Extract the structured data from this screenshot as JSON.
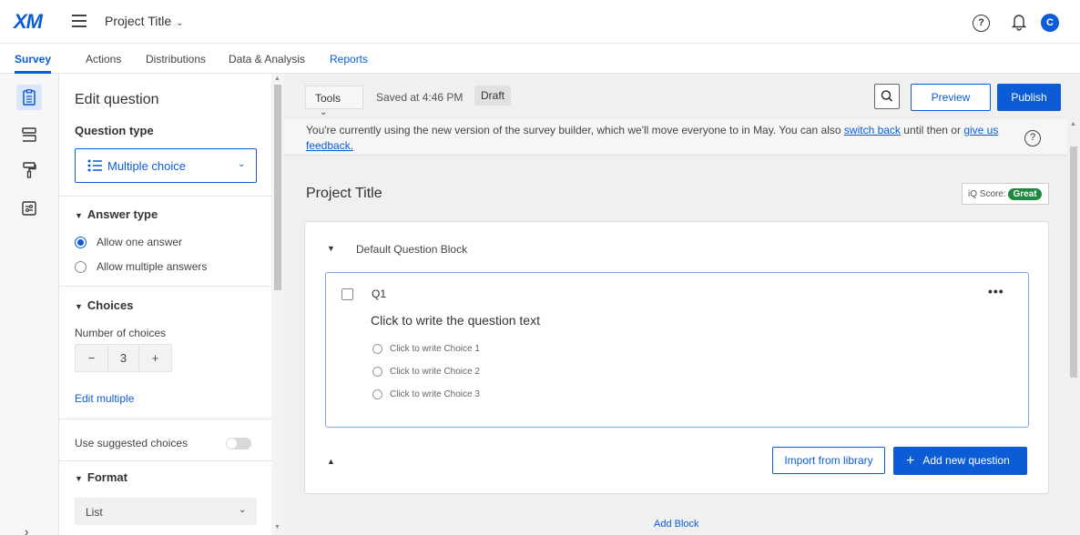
{
  "app": {
    "logo": "XM",
    "project_title": "Project Title",
    "user_initial": "C",
    "brand_color": "#0b5cd5"
  },
  "topbar": {
    "menu_icon": "hamburger-icon",
    "help_icon": "help-icon",
    "notification_icon": "bell-icon",
    "help_glyph": "?"
  },
  "nav": {
    "tabs": [
      {
        "label": "Survey",
        "active": true
      },
      {
        "label": "Actions"
      },
      {
        "label": "Distributions"
      },
      {
        "label": "Data & Analysis"
      },
      {
        "label": "Reports"
      }
    ]
  },
  "rail": {
    "icons": [
      "survey-icon",
      "blocks-icon",
      "look-and-feel-icon",
      "survey-options-icon"
    ],
    "expand_glyph": "›"
  },
  "edit_panel": {
    "title": "Edit question",
    "question_type_label": "Question type",
    "question_type_value": "Multiple choice",
    "answer_type_label": "Answer type",
    "answer_options": [
      {
        "label": "Allow one answer",
        "checked": true
      },
      {
        "label": "Allow multiple answers",
        "checked": false
      }
    ],
    "choices_label": "Choices",
    "number_of_choices_label": "Number of choices",
    "stepper": {
      "minus": "−",
      "value": "3",
      "plus": "+"
    },
    "edit_multiple": "Edit multiple",
    "use_suggested_label": "Use suggested choices",
    "use_suggested_on": false,
    "format_label": "Format",
    "format_value": "List"
  },
  "toolbar": {
    "tools_label": "Tools",
    "saved_text": "Saved at 4:46 PM",
    "draft_badge": "Draft",
    "preview_label": "Preview",
    "publish_label": "Publish"
  },
  "banner": {
    "text_before": "You're currently using the new version of the survey builder, which we'll move everyone to in May. You can also ",
    "link_switch": "switch back",
    "text_middle": " until then or ",
    "link_feedback_1": "give us",
    "link_feedback_2": "feedback."
  },
  "survey": {
    "title": "Project Title",
    "iq_label": "iQ Score:",
    "iq_value": "Great",
    "block_name": "Default Question Block",
    "question": {
      "id": "Q1",
      "text": "Click to write the question text",
      "choices": [
        "Click to write Choice 1",
        "Click to write Choice 2",
        "Click to write Choice 3"
      ],
      "more_glyph": "•••"
    },
    "import_label": "Import from library",
    "add_question_label": "Add new question",
    "add_block_label": "Add Block"
  }
}
